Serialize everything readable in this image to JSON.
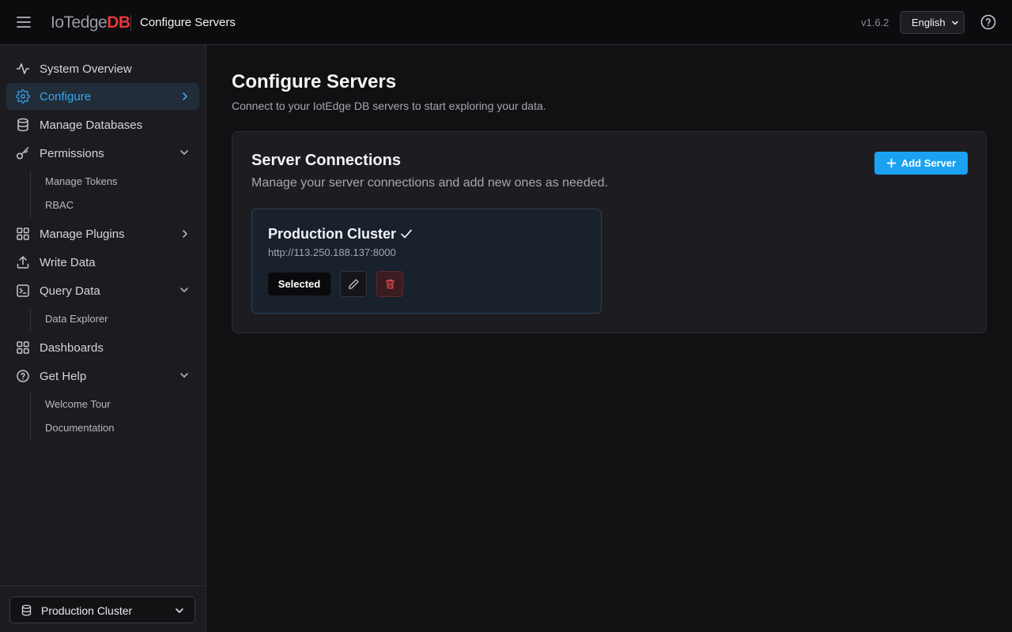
{
  "header": {
    "logo_part1": "IoTedge",
    "logo_part2": "DB",
    "title": "Configure Servers",
    "version": "v1.6.2",
    "language": "English",
    "menu_icon": "hamburger-icon",
    "help_icon": "help-circle-icon"
  },
  "sidebar": {
    "items": [
      {
        "label": "System Overview",
        "icon": "activity-icon"
      },
      {
        "label": "Configure",
        "icon": "gear-icon",
        "active": true
      },
      {
        "label": "Manage Databases",
        "icon": "database-icon"
      },
      {
        "label": "Permissions",
        "icon": "key-icon"
      },
      {
        "label": "Manage Plugins",
        "icon": "grid-icon"
      },
      {
        "label": "Write Data",
        "icon": "upload-icon"
      },
      {
        "label": "Query Data",
        "icon": "terminal-icon"
      },
      {
        "label": "Dashboards",
        "icon": "grid-icon"
      },
      {
        "label": "Get Help",
        "icon": "help-circle-icon"
      }
    ],
    "permissions_sub": [
      "Manage Tokens",
      "RBAC"
    ],
    "query_sub": [
      "Data Explorer"
    ],
    "help_sub": [
      "Welcome Tour",
      "Documentation"
    ],
    "server_selector": "Production Cluster"
  },
  "main": {
    "title": "Configure Servers",
    "subtitle": "Connect to your IotEdge DB servers to start exploring your data.",
    "panel": {
      "title": "Server Connections",
      "subtitle": "Manage your server connections and add new ones as needed.",
      "add_button": "Add Server"
    },
    "server": {
      "name": "Production Cluster",
      "url": "http://113.250.188.137:8000",
      "status": "Selected"
    }
  },
  "colors": {
    "accent": "#1ba1f2",
    "active_text": "#33a9ee",
    "logo_red": "#e5373d",
    "danger": "#e5484d"
  }
}
